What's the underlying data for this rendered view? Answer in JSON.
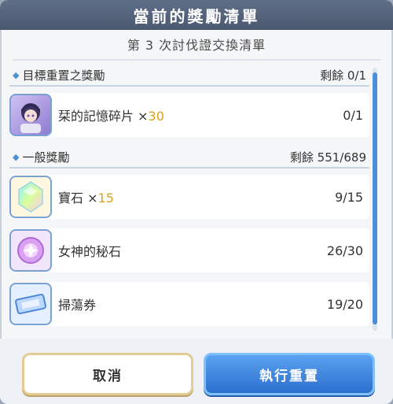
{
  "dialog": {
    "title": "當前的獎勵清單",
    "subtitle": "第 3 次討伐證交換清單"
  },
  "target_section": {
    "title": "目標重置之獎勵",
    "remaining_label": "剩餘 0/1",
    "items": [
      {
        "name": "栞的記憶碎片",
        "multiplier_prefix": " ×",
        "multiplier": "30",
        "count": "0/1",
        "icon": "character-portrait-icon"
      }
    ]
  },
  "general_section": {
    "title": "一般獎勵",
    "remaining_label": "剩餘 551/689",
    "items": [
      {
        "name": "寶石",
        "multiplier_prefix": " ×",
        "multiplier": "15",
        "count": "9/15",
        "icon": "gem-icon"
      },
      {
        "name": "女神的秘石",
        "multiplier_prefix": "",
        "multiplier": "",
        "count": "26/30",
        "icon": "goddess-stone-icon"
      },
      {
        "name": "掃蕩券",
        "multiplier_prefix": "",
        "multiplier": "",
        "count": "19/20",
        "icon": "ticket-icon"
      }
    ]
  },
  "buttons": {
    "cancel": "取消",
    "reset": "執行重置"
  },
  "colors": {
    "title_bar": "#52627a",
    "accent_blue": "#4c8fd4",
    "multiplier_gold": "#d9a321"
  }
}
